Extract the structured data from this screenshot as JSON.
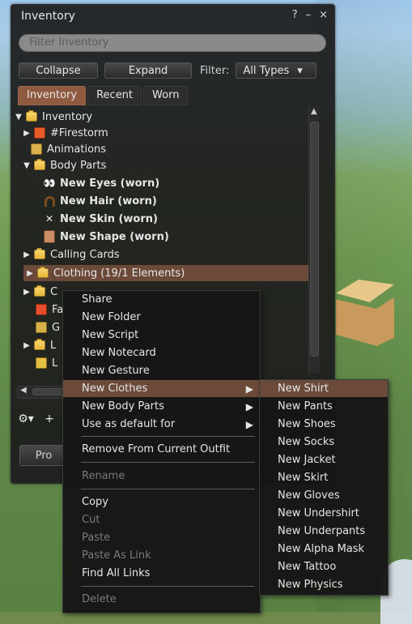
{
  "window": {
    "title": "Inventory",
    "help": "?",
    "minimize": "–",
    "close": "×"
  },
  "filter": {
    "placeholder": "Filter Inventory"
  },
  "toolbar": {
    "collapse": "Collapse",
    "expand": "Expand",
    "filter_label": "Filter:",
    "types_value": "All Types",
    "types_arrow": "▾"
  },
  "tabs": [
    {
      "label": "Inventory",
      "active": true
    },
    {
      "label": "Recent",
      "active": false
    },
    {
      "label": "Worn",
      "active": false
    }
  ],
  "tree": [
    {
      "label": "Inventory",
      "icon": "folder-open-icon",
      "expanded": true
    },
    {
      "label": "#Firestorm",
      "icon": "firestorm-folder-icon",
      "expanded": false
    },
    {
      "label": "Animations",
      "icon": "animations-folder-icon",
      "expanded": null
    },
    {
      "label": "Body Parts",
      "icon": "bodyparts-folder-icon",
      "expanded": true
    },
    {
      "label": "New Eyes (worn)",
      "icon": "eyes-icon",
      "bold": true
    },
    {
      "label": "New Hair (worn)",
      "icon": "hair-icon",
      "bold": true
    },
    {
      "label": "New Skin (worn)",
      "icon": "skin-icon",
      "bold": true
    },
    {
      "label": "New Shape (worn)",
      "icon": "shape-icon",
      "bold": true
    },
    {
      "label": "Calling Cards",
      "icon": "calling-cards-folder-icon",
      "expanded": false
    },
    {
      "label": "Clothing (19/1 Elements)",
      "icon": "clothing-folder-icon",
      "expanded": false,
      "selected": true
    },
    {
      "label": "C",
      "icon": "folder-icon",
      "expanded": false
    },
    {
      "label": "Fa",
      "icon": "favorites-folder-icon",
      "expanded": null
    },
    {
      "label": "G",
      "icon": "gestures-folder-icon",
      "expanded": null
    },
    {
      "label": "L",
      "icon": "landmarks-folder-icon",
      "expanded": false
    },
    {
      "label": "L",
      "icon": "lost-and-found-folder-icon",
      "expanded": null
    }
  ],
  "bottom": {
    "gear": "⚙▾",
    "plus": "+",
    "properties": "Pro"
  },
  "context_menu": {
    "items": [
      {
        "label": "Share",
        "enabled": true
      },
      {
        "label": "New Folder",
        "enabled": true
      },
      {
        "label": "New Script",
        "enabled": true
      },
      {
        "label": "New Notecard",
        "enabled": true
      },
      {
        "label": "New Gesture",
        "enabled": true
      },
      {
        "label": "New Clothes",
        "enabled": true,
        "submenu": true,
        "hover": true
      },
      {
        "label": "New Body Parts",
        "enabled": true,
        "submenu": true
      },
      {
        "label": "Use as default for",
        "enabled": true,
        "submenu": true
      },
      {
        "label": "Remove From Current Outfit",
        "enabled": true
      },
      {
        "label": "Rename",
        "enabled": false
      },
      {
        "label": "Copy",
        "enabled": true
      },
      {
        "label": "Cut",
        "enabled": false
      },
      {
        "label": "Paste",
        "enabled": false
      },
      {
        "label": "Paste As Link",
        "enabled": false
      },
      {
        "label": "Find All Links",
        "enabled": true
      },
      {
        "label": "Delete",
        "enabled": false
      }
    ],
    "submenu_arrow": "▶"
  },
  "submenu_new_clothes": {
    "items": [
      {
        "label": "New Shirt",
        "hover": true
      },
      {
        "label": "New Pants"
      },
      {
        "label": "New Shoes"
      },
      {
        "label": "New Socks"
      },
      {
        "label": "New Jacket"
      },
      {
        "label": "New Skirt"
      },
      {
        "label": "New Gloves"
      },
      {
        "label": "New Undershirt"
      },
      {
        "label": "New Underpants"
      },
      {
        "label": "New Alpha Mask"
      },
      {
        "label": "New Tattoo"
      },
      {
        "label": "New Physics"
      }
    ]
  },
  "colors": {
    "accent": "#6c4a3a",
    "active_tab": "#8f5a3f",
    "panel_bg": "#1c1c1c",
    "text": "#e6e6e6",
    "disabled_text": "#7a7a7a",
    "folder": "#f1c54a"
  }
}
